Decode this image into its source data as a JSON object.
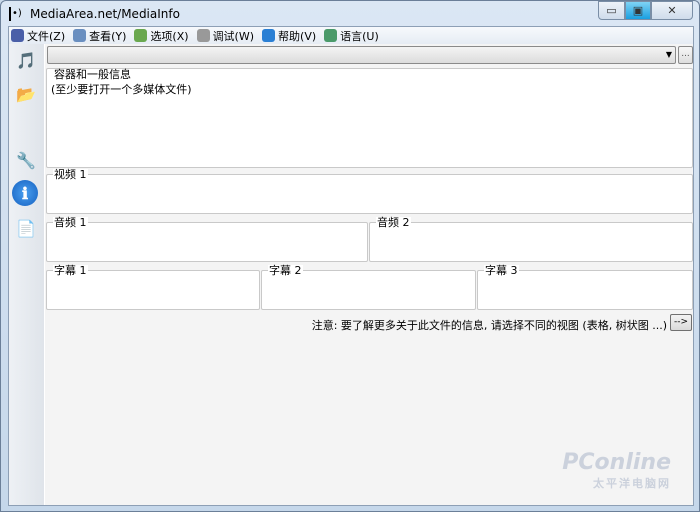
{
  "window": {
    "title": "MediaArea.net/MediaInfo",
    "min": "▭",
    "max": "▣",
    "close": "✕"
  },
  "menu": [
    {
      "label": "文件(Z)",
      "icon": "file-icon",
      "color": "#4a5fa8"
    },
    {
      "label": "查看(Y)",
      "icon": "view-icon",
      "color": "#6a8fc0"
    },
    {
      "label": "选项(X)",
      "icon": "options-icon",
      "color": "#6aa84f"
    },
    {
      "label": "调试(W)",
      "icon": "debug-icon",
      "color": "#999999"
    },
    {
      "label": "帮助(V)",
      "icon": "help-icon",
      "color": "#2a7fd4"
    },
    {
      "label": "语言(U)",
      "icon": "language-icon",
      "color": "#4a9a6a"
    }
  ],
  "sidebar": [
    {
      "icon": "open-file-icon",
      "glyph": "🎵"
    },
    {
      "icon": "open-folder-icon",
      "glyph": "📂"
    },
    {
      "icon": "preferences-icon",
      "glyph": "🔧"
    },
    {
      "icon": "info-icon",
      "glyph": "ℹ"
    },
    {
      "icon": "export-icon",
      "glyph": "📄"
    }
  ],
  "combo": {
    "value": "",
    "dots": "..."
  },
  "general": {
    "label": "容器和一般信息",
    "text": "(至少要打开一个多媒体文件)"
  },
  "video": {
    "label": "视频 1"
  },
  "audio": [
    {
      "label": "音频 1"
    },
    {
      "label": "音频 2"
    }
  ],
  "subtitles": [
    {
      "label": "字幕 1"
    },
    {
      "label": "字幕 2"
    },
    {
      "label": "字幕 3"
    }
  ],
  "note": {
    "text": "注意: 要了解更多关于此文件的信息, 请选择不同的视图 (表格, 树状图 ...)",
    "button": "-->"
  },
  "watermark": {
    "text": "PConline",
    "sub": "太平洋电脑网"
  }
}
